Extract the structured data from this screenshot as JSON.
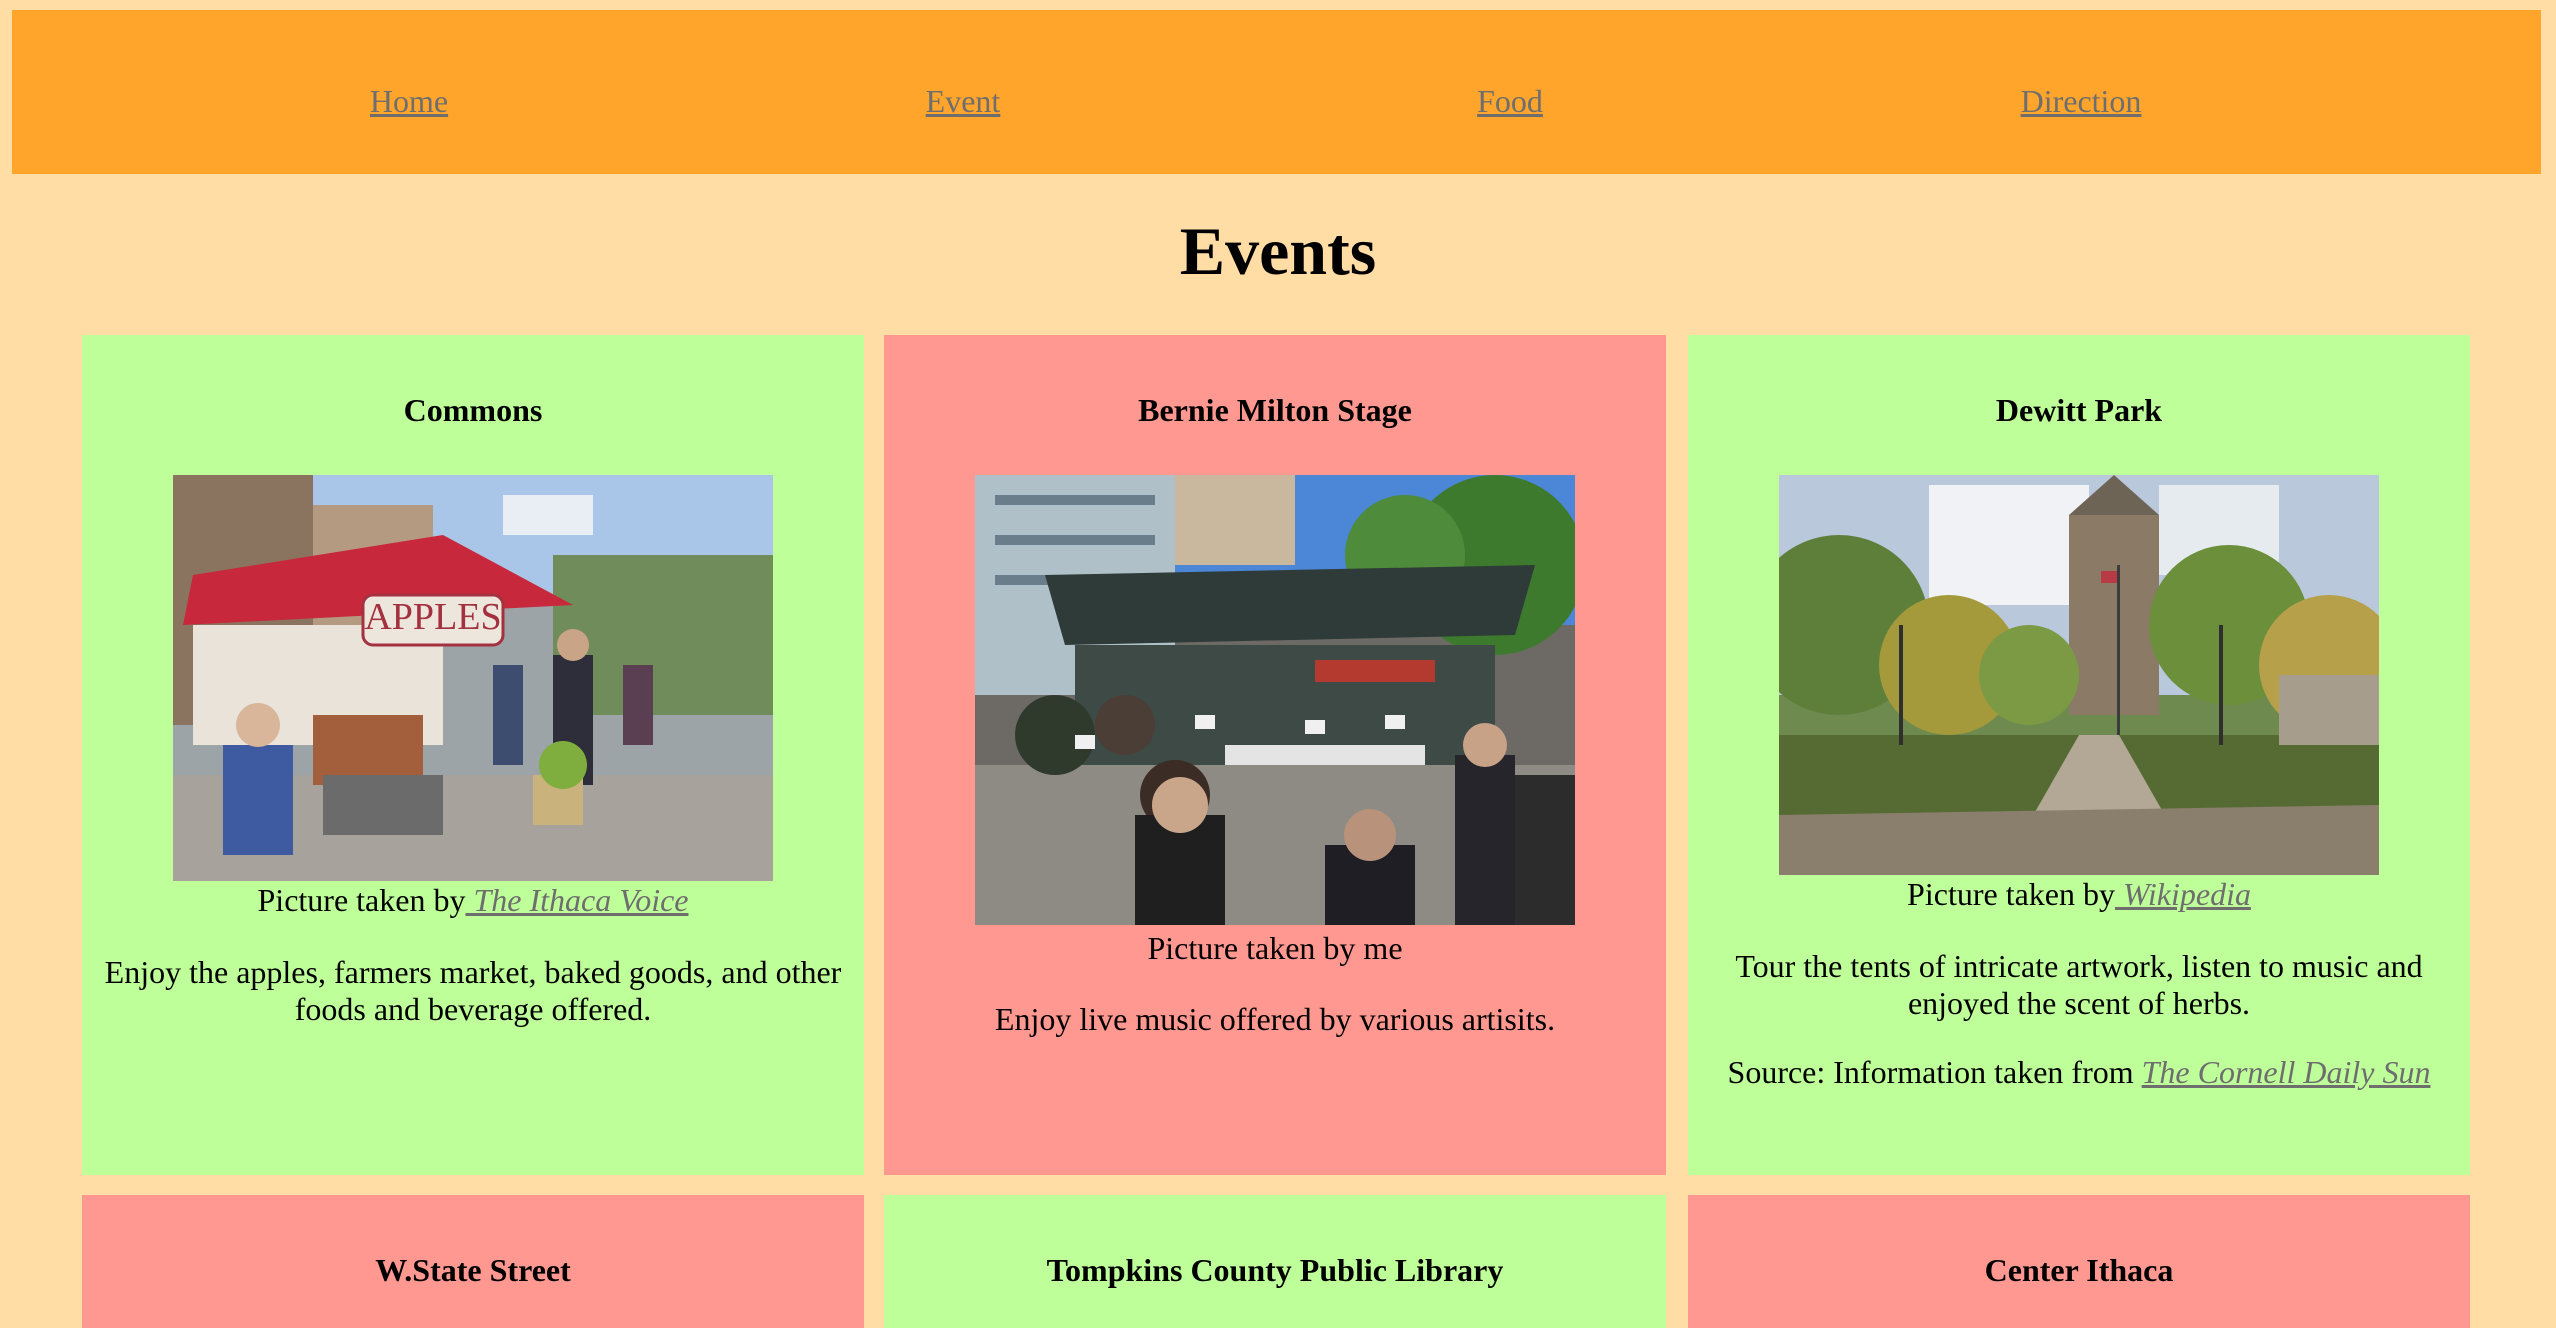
{
  "nav": {
    "items": [
      {
        "label": "Home"
      },
      {
        "label": "Event"
      },
      {
        "label": "Food"
      },
      {
        "label": "Direction"
      }
    ]
  },
  "page": {
    "title": "Events"
  },
  "cards": [
    {
      "title": "Commons",
      "caption_prefix": "Picture taken by",
      "caption_link": " The Ithaca Voice",
      "description": "Enjoy the apples, farmers market, baked goods, and other foods and beverage offered.",
      "photo_sign": "APPLES"
    },
    {
      "title": "Bernie Milton Stage",
      "caption_prefix": "Picture taken by me",
      "description": "Enjoy live music offered by various artisits."
    },
    {
      "title": "Dewitt Park",
      "caption_prefix": "Picture taken by",
      "caption_link": " Wikipedia",
      "description": "Tour the tents of intricate artwork, listen to music and enjoyed the scent of herbs.",
      "source_prefix": "Source: Information taken from ",
      "source_link": "The Cornell Daily Sun"
    },
    {
      "title": "W.State Street"
    },
    {
      "title": "Tompkins County Public Library"
    },
    {
      "title": "Center Ithaca"
    }
  ],
  "colors": {
    "background": "#FFDDA5",
    "navbar": "#FFA52C",
    "link": "#6E6E6E",
    "card_green": "#BEFF9A",
    "card_red": "#FF9890"
  }
}
